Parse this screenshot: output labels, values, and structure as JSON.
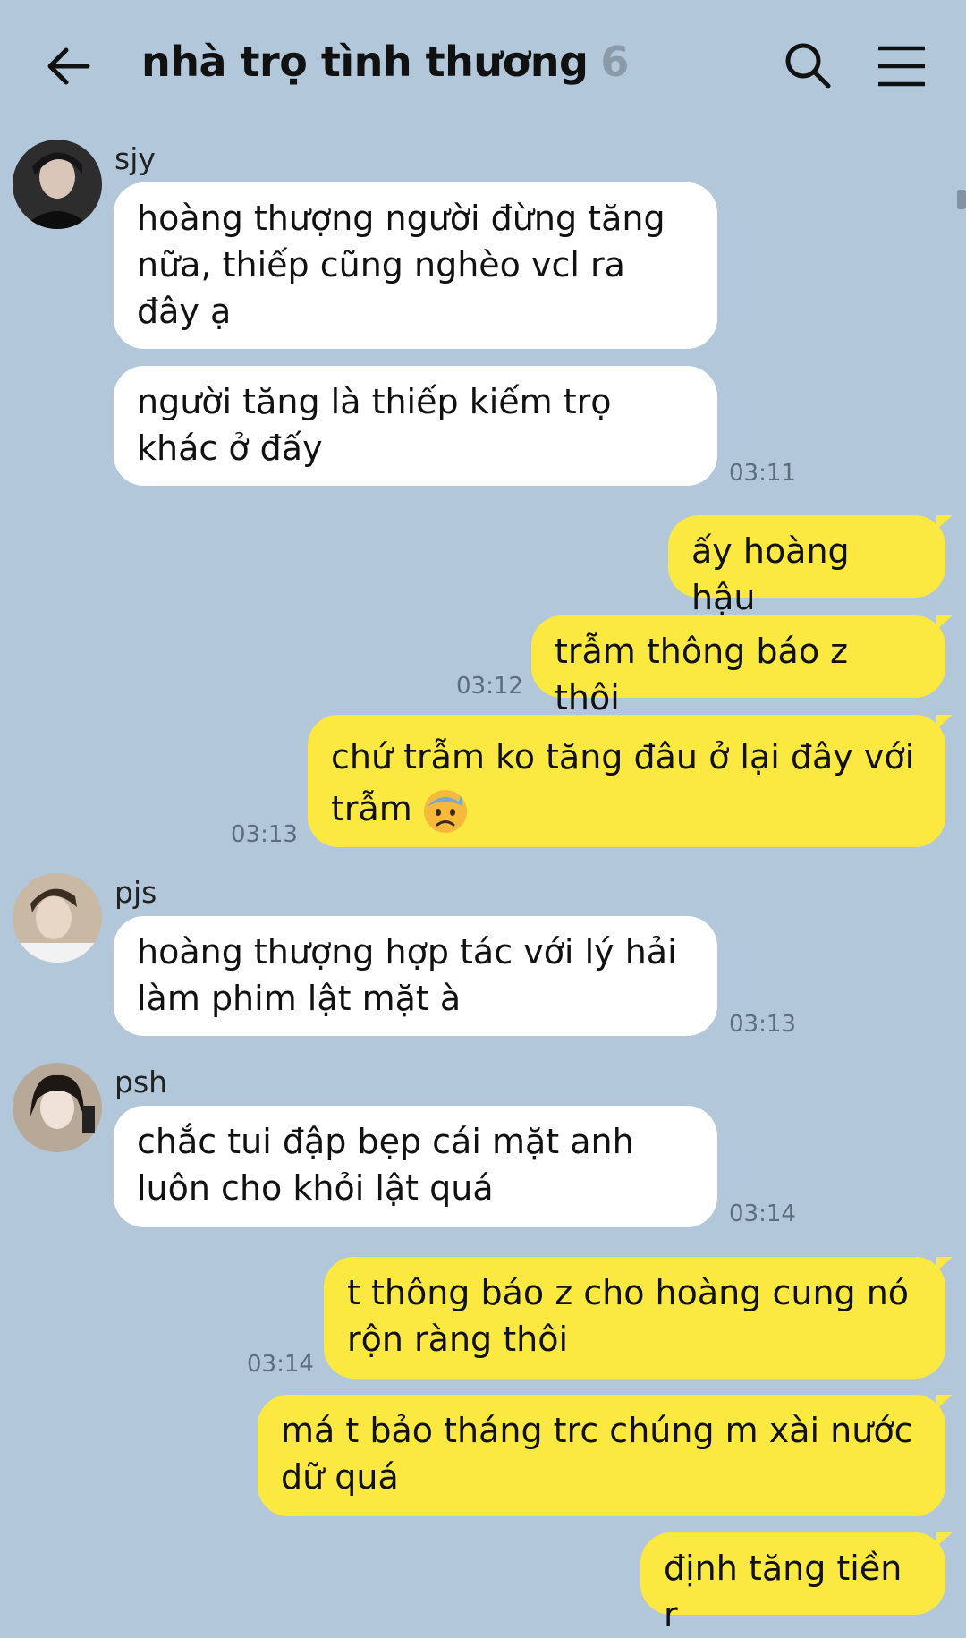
{
  "header": {
    "title": "nhà trọ tình thương",
    "member_count": "6"
  },
  "messages": [
    {
      "sender": "sjy",
      "text": "hoàng thượng người đừng tăng nữa, thiếp cũng nghèo vcl ra đây ạ"
    },
    {
      "text": "người tăng là thiếp kiếm trọ khác ở đấy",
      "time": "03:11"
    },
    {
      "text": "ấy hoàng hậu"
    },
    {
      "text": "trẫm thông báo z thôi",
      "time": "03:12"
    },
    {
      "text": "chứ trẫm ko tăng đâu ở lại đây với trẫm",
      "time": "03:13",
      "emoji": "anxious-sweat-face"
    },
    {
      "sender": "pjs",
      "text": "hoàng thượng hợp tác với lý hải làm phim lật mặt à",
      "time": "03:13"
    },
    {
      "sender": "psh",
      "text": "chắc tui đập bẹp cái mặt anh luôn cho khỏi lật quá",
      "time": "03:14"
    },
    {
      "text": "t thông báo z cho hoàng cung nó rộn ràng thôi",
      "time": "03:14"
    },
    {
      "text": "má t bảo tháng trc chúng m xài nước dữ quá"
    },
    {
      "text": "định tăng tiền r"
    }
  ],
  "colors": {
    "background": "#b2c7da",
    "incoming_bubble": "#ffffff",
    "outgoing_bubble": "#fbe840"
  }
}
